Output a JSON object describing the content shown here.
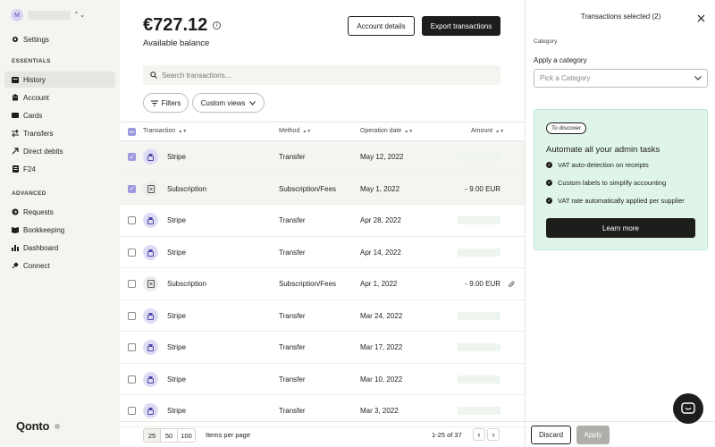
{
  "sidebar": {
    "org_initial": "M",
    "settings": "Settings",
    "section_essentials": "ESSENTIALS",
    "section_advanced": "ADVANCED",
    "items": [
      {
        "label": "History",
        "icon": "history-icon"
      },
      {
        "label": "Account",
        "icon": "account-icon"
      },
      {
        "label": "Cards",
        "icon": "card-icon"
      },
      {
        "label": "Transfers",
        "icon": "transfer-icon"
      },
      {
        "label": "Direct debits",
        "icon": "direct-debit-icon"
      },
      {
        "label": "F24",
        "icon": "f24-icon"
      },
      {
        "label": "Requests",
        "icon": "requests-icon"
      },
      {
        "label": "Bookkeeping",
        "icon": "bookkeeping-icon"
      },
      {
        "label": "Dashboard",
        "icon": "dashboard-icon"
      },
      {
        "label": "Connect",
        "icon": "connect-icon"
      }
    ],
    "logo": "Qonto"
  },
  "header": {
    "balance": "€727.12",
    "balance_label": "Available balance",
    "account_details": "Account details",
    "export": "Export transactions"
  },
  "search": {
    "placeholder": "Search transactions..."
  },
  "filters": {
    "filters_label": "Filters",
    "custom_views_label": "Custom views"
  },
  "table": {
    "columns": {
      "transaction": "Transaction",
      "method": "Method",
      "date": "Operation date",
      "amount": "Amount"
    },
    "rows": [
      {
        "name": "Stripe",
        "type": "stripe",
        "method": "Transfer",
        "date": "May 12, 2022",
        "amount": "",
        "selected": true
      },
      {
        "name": "Subscription",
        "type": "sub",
        "method": "Subscription/Fees",
        "date": "May 1, 2022",
        "amount": "- 9.00 EUR",
        "selected": true
      },
      {
        "name": "Stripe",
        "type": "stripe",
        "method": "Transfer",
        "date": "Apr 28, 2022",
        "amount": "",
        "selected": false
      },
      {
        "name": "Stripe",
        "type": "stripe",
        "method": "Transfer",
        "date": "Apr 14, 2022",
        "amount": "",
        "selected": false
      },
      {
        "name": "Subscription",
        "type": "sub",
        "method": "Subscription/Fees",
        "date": "Apr 1, 2022",
        "amount": "- 9.00 EUR",
        "selected": false,
        "attachment": true
      },
      {
        "name": "Stripe",
        "type": "stripe",
        "method": "Transfer",
        "date": "Mar 24, 2022",
        "amount": "",
        "selected": false
      },
      {
        "name": "Stripe",
        "type": "stripe",
        "method": "Transfer",
        "date": "Mar 17, 2022",
        "amount": "",
        "selected": false
      },
      {
        "name": "Stripe",
        "type": "stripe",
        "method": "Transfer",
        "date": "Mar 10, 2022",
        "amount": "",
        "selected": false
      },
      {
        "name": "Stripe",
        "type": "stripe",
        "method": "Transfer",
        "date": "Mar 3, 2022",
        "amount": "",
        "selected": false
      }
    ]
  },
  "pagination": {
    "per_page_options": [
      "25",
      "50",
      "100"
    ],
    "per_page_selected": "25",
    "per_page_label": "Items per page",
    "range": "1-25 of 37"
  },
  "panel": {
    "title": "Transactions selected (2)",
    "category_label": "Category",
    "apply_category_label": "Apply a category",
    "category_placeholder": "Pick a Category",
    "promo": {
      "badge": "To discover",
      "title": "Automate all your admin tasks",
      "features": [
        "VAT auto-detection on receipts",
        "Custom labels to simplify accounting",
        "VAT rate automatically applied per supplier"
      ],
      "button": "Learn more"
    },
    "discard": "Discard",
    "apply": "Apply"
  },
  "colors": {
    "accent": "#9e9ae0",
    "promo_bg": "#e0f5ea",
    "dark": "#1d1d1b"
  }
}
